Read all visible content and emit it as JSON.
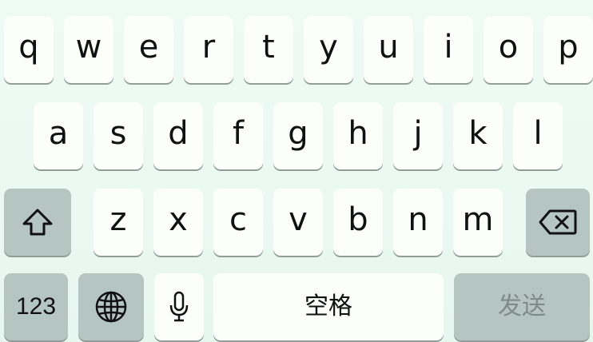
{
  "keyboard": {
    "row1": [
      "q",
      "w",
      "e",
      "r",
      "t",
      "y",
      "u",
      "i",
      "o",
      "p"
    ],
    "row2": [
      "a",
      "s",
      "d",
      "f",
      "g",
      "h",
      "j",
      "k",
      "l"
    ],
    "row3": [
      "z",
      "x",
      "c",
      "v",
      "b",
      "n",
      "m"
    ],
    "numbers_label": "123",
    "space_label": "空格",
    "send_label": "发送",
    "icons": {
      "shift": "shift-arrow-icon",
      "delete": "backspace-icon",
      "globe": "globe-icon",
      "mic": "microphone-icon"
    },
    "colors": {
      "key_bg": "#fbfef9",
      "function_key_bg": "#b5c5c2",
      "send_text": "#7f8b89",
      "background": "#eaf9f2"
    }
  }
}
